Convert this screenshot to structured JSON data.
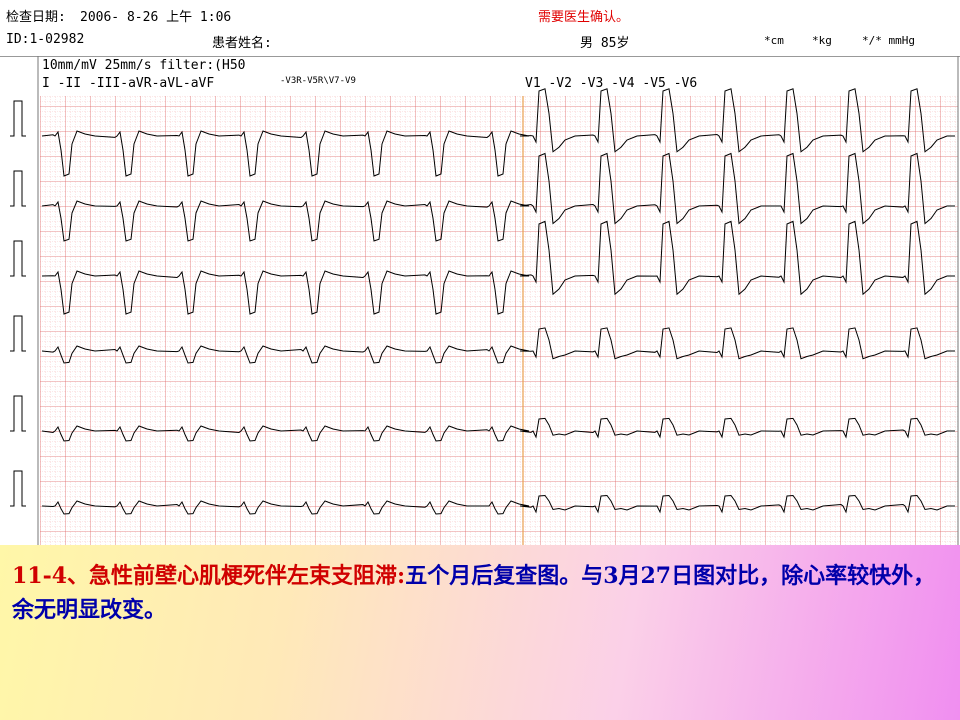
{
  "header": {
    "exam_date_label": "检查日期:",
    "exam_date_value": "2006- 8-26  上午 1:06",
    "confirm_note": "需要医生确认。",
    "id_text": "ID:1-02982",
    "patient_name_label": "患者姓名:",
    "sex_age": "男  85岁",
    "unit_cm": "*cm",
    "unit_kg": "*kg",
    "unit_mmhg": "*/* mmHg"
  },
  "ecg": {
    "settings": "10mm/mV 25mm/s filter:(H50",
    "limb_leads": "I  -II -III-aVR-aVL-aVF",
    "right_leads": "-V3R-V5R\\V7-V9",
    "chest_leads": "V1 -V2 -V3 -V4 -V5 -V6"
  },
  "caption": {
    "title": "11-4、急性前壁心肌梗死伴左束支阻滞:",
    "body": "五个月后复查图。与3月27日图对比，除心率较快外，余无明显改变。"
  }
}
